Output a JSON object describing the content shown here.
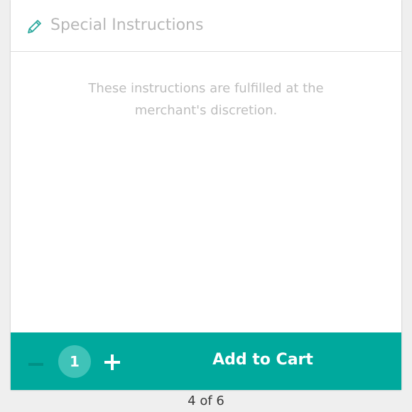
{
  "instructions": {
    "icon": "pencil-icon",
    "placeholder": "Special Instructions",
    "note_line1": "These instructions are fulfilled at the",
    "note_line2": "merchant's discretion."
  },
  "cart_bar": {
    "decrease_symbol": "−",
    "quantity": "1",
    "increase_symbol": "+",
    "add_label": "Add to Cart",
    "background_color": "#00a99d"
  },
  "pager": {
    "label": "4 of 6"
  }
}
